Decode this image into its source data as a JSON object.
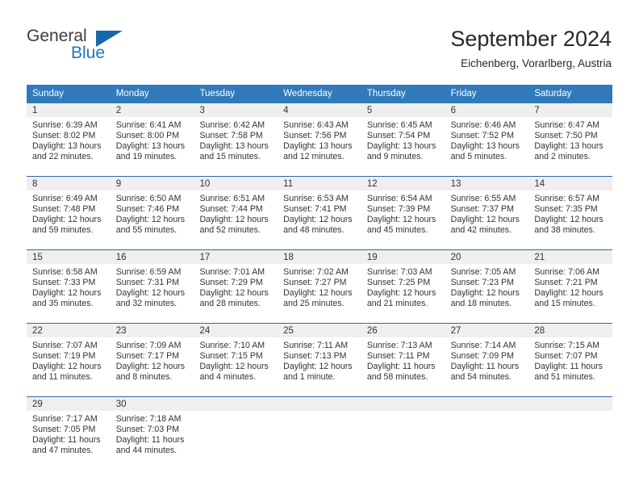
{
  "brand": {
    "name_top": "General",
    "name_bottom": "Blue",
    "triangle_color": "#1767ab",
    "blue_color": "#1e76bd"
  },
  "header": {
    "title": "September 2024",
    "location": "Eichenberg, Vorarlberg, Austria"
  },
  "theme": {
    "header_bar": "#3079bb",
    "row_divider": "#2e6ca4",
    "day_band": "#efefef",
    "text": "#333333"
  },
  "weekdays": [
    "Sunday",
    "Monday",
    "Tuesday",
    "Wednesday",
    "Thursday",
    "Friday",
    "Saturday"
  ],
  "weeks": [
    [
      {
        "day": "1",
        "sunrise": "Sunrise: 6:39 AM",
        "sunset": "Sunset: 8:02 PM",
        "daylight_1": "Daylight: 13 hours",
        "daylight_2": "and 22 minutes."
      },
      {
        "day": "2",
        "sunrise": "Sunrise: 6:41 AM",
        "sunset": "Sunset: 8:00 PM",
        "daylight_1": "Daylight: 13 hours",
        "daylight_2": "and 19 minutes."
      },
      {
        "day": "3",
        "sunrise": "Sunrise: 6:42 AM",
        "sunset": "Sunset: 7:58 PM",
        "daylight_1": "Daylight: 13 hours",
        "daylight_2": "and 15 minutes."
      },
      {
        "day": "4",
        "sunrise": "Sunrise: 6:43 AM",
        "sunset": "Sunset: 7:56 PM",
        "daylight_1": "Daylight: 13 hours",
        "daylight_2": "and 12 minutes."
      },
      {
        "day": "5",
        "sunrise": "Sunrise: 6:45 AM",
        "sunset": "Sunset: 7:54 PM",
        "daylight_1": "Daylight: 13 hours",
        "daylight_2": "and 9 minutes."
      },
      {
        "day": "6",
        "sunrise": "Sunrise: 6:46 AM",
        "sunset": "Sunset: 7:52 PM",
        "daylight_1": "Daylight: 13 hours",
        "daylight_2": "and 5 minutes."
      },
      {
        "day": "7",
        "sunrise": "Sunrise: 6:47 AM",
        "sunset": "Sunset: 7:50 PM",
        "daylight_1": "Daylight: 13 hours",
        "daylight_2": "and 2 minutes."
      }
    ],
    [
      {
        "day": "8",
        "sunrise": "Sunrise: 6:49 AM",
        "sunset": "Sunset: 7:48 PM",
        "daylight_1": "Daylight: 12 hours",
        "daylight_2": "and 59 minutes."
      },
      {
        "day": "9",
        "sunrise": "Sunrise: 6:50 AM",
        "sunset": "Sunset: 7:46 PM",
        "daylight_1": "Daylight: 12 hours",
        "daylight_2": "and 55 minutes."
      },
      {
        "day": "10",
        "sunrise": "Sunrise: 6:51 AM",
        "sunset": "Sunset: 7:44 PM",
        "daylight_1": "Daylight: 12 hours",
        "daylight_2": "and 52 minutes."
      },
      {
        "day": "11",
        "sunrise": "Sunrise: 6:53 AM",
        "sunset": "Sunset: 7:41 PM",
        "daylight_1": "Daylight: 12 hours",
        "daylight_2": "and 48 minutes."
      },
      {
        "day": "12",
        "sunrise": "Sunrise: 6:54 AM",
        "sunset": "Sunset: 7:39 PM",
        "daylight_1": "Daylight: 12 hours",
        "daylight_2": "and 45 minutes."
      },
      {
        "day": "13",
        "sunrise": "Sunrise: 6:55 AM",
        "sunset": "Sunset: 7:37 PM",
        "daylight_1": "Daylight: 12 hours",
        "daylight_2": "and 42 minutes."
      },
      {
        "day": "14",
        "sunrise": "Sunrise: 6:57 AM",
        "sunset": "Sunset: 7:35 PM",
        "daylight_1": "Daylight: 12 hours",
        "daylight_2": "and 38 minutes."
      }
    ],
    [
      {
        "day": "15",
        "sunrise": "Sunrise: 6:58 AM",
        "sunset": "Sunset: 7:33 PM",
        "daylight_1": "Daylight: 12 hours",
        "daylight_2": "and 35 minutes."
      },
      {
        "day": "16",
        "sunrise": "Sunrise: 6:59 AM",
        "sunset": "Sunset: 7:31 PM",
        "daylight_1": "Daylight: 12 hours",
        "daylight_2": "and 32 minutes."
      },
      {
        "day": "17",
        "sunrise": "Sunrise: 7:01 AM",
        "sunset": "Sunset: 7:29 PM",
        "daylight_1": "Daylight: 12 hours",
        "daylight_2": "and 28 minutes."
      },
      {
        "day": "18",
        "sunrise": "Sunrise: 7:02 AM",
        "sunset": "Sunset: 7:27 PM",
        "daylight_1": "Daylight: 12 hours",
        "daylight_2": "and 25 minutes."
      },
      {
        "day": "19",
        "sunrise": "Sunrise: 7:03 AM",
        "sunset": "Sunset: 7:25 PM",
        "daylight_1": "Daylight: 12 hours",
        "daylight_2": "and 21 minutes."
      },
      {
        "day": "20",
        "sunrise": "Sunrise: 7:05 AM",
        "sunset": "Sunset: 7:23 PM",
        "daylight_1": "Daylight: 12 hours",
        "daylight_2": "and 18 minutes."
      },
      {
        "day": "21",
        "sunrise": "Sunrise: 7:06 AM",
        "sunset": "Sunset: 7:21 PM",
        "daylight_1": "Daylight: 12 hours",
        "daylight_2": "and 15 minutes."
      }
    ],
    [
      {
        "day": "22",
        "sunrise": "Sunrise: 7:07 AM",
        "sunset": "Sunset: 7:19 PM",
        "daylight_1": "Daylight: 12 hours",
        "daylight_2": "and 11 minutes."
      },
      {
        "day": "23",
        "sunrise": "Sunrise: 7:09 AM",
        "sunset": "Sunset: 7:17 PM",
        "daylight_1": "Daylight: 12 hours",
        "daylight_2": "and 8 minutes."
      },
      {
        "day": "24",
        "sunrise": "Sunrise: 7:10 AM",
        "sunset": "Sunset: 7:15 PM",
        "daylight_1": "Daylight: 12 hours",
        "daylight_2": "and 4 minutes."
      },
      {
        "day": "25",
        "sunrise": "Sunrise: 7:11 AM",
        "sunset": "Sunset: 7:13 PM",
        "daylight_1": "Daylight: 12 hours",
        "daylight_2": "and 1 minute."
      },
      {
        "day": "26",
        "sunrise": "Sunrise: 7:13 AM",
        "sunset": "Sunset: 7:11 PM",
        "daylight_1": "Daylight: 11 hours",
        "daylight_2": "and 58 minutes."
      },
      {
        "day": "27",
        "sunrise": "Sunrise: 7:14 AM",
        "sunset": "Sunset: 7:09 PM",
        "daylight_1": "Daylight: 11 hours",
        "daylight_2": "and 54 minutes."
      },
      {
        "day": "28",
        "sunrise": "Sunrise: 7:15 AM",
        "sunset": "Sunset: 7:07 PM",
        "daylight_1": "Daylight: 11 hours",
        "daylight_2": "and 51 minutes."
      }
    ],
    [
      {
        "day": "29",
        "sunrise": "Sunrise: 7:17 AM",
        "sunset": "Sunset: 7:05 PM",
        "daylight_1": "Daylight: 11 hours",
        "daylight_2": "and 47 minutes."
      },
      {
        "day": "30",
        "sunrise": "Sunrise: 7:18 AM",
        "sunset": "Sunset: 7:03 PM",
        "daylight_1": "Daylight: 11 hours",
        "daylight_2": "and 44 minutes."
      },
      {
        "day": "",
        "sunrise": "",
        "sunset": "",
        "daylight_1": "",
        "daylight_2": ""
      },
      {
        "day": "",
        "sunrise": "",
        "sunset": "",
        "daylight_1": "",
        "daylight_2": ""
      },
      {
        "day": "",
        "sunrise": "",
        "sunset": "",
        "daylight_1": "",
        "daylight_2": ""
      },
      {
        "day": "",
        "sunrise": "",
        "sunset": "",
        "daylight_1": "",
        "daylight_2": ""
      },
      {
        "day": "",
        "sunrise": "",
        "sunset": "",
        "daylight_1": "",
        "daylight_2": ""
      }
    ]
  ]
}
